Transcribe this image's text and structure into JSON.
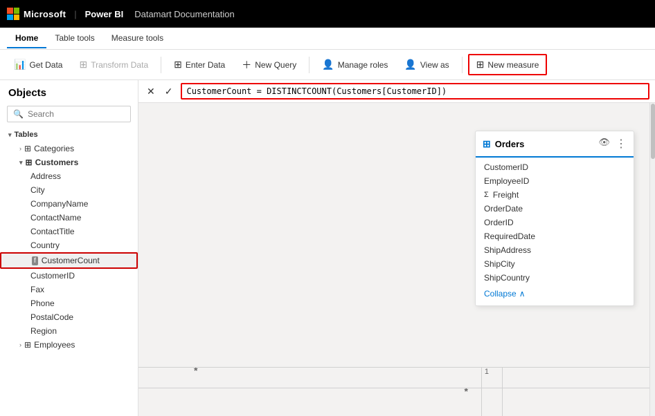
{
  "titleBar": {
    "microsoftText": "Microsoft",
    "powerBIText": "Power BI",
    "divider": "|",
    "docTitle": "Datamart Documentation"
  },
  "ribbonTabs": [
    {
      "label": "Home",
      "active": true
    },
    {
      "label": "Table tools",
      "active": false
    },
    {
      "label": "Measure tools",
      "active": false
    }
  ],
  "toolbar": {
    "getDataLabel": "Get Data",
    "transformDataLabel": "Transform Data",
    "enterDataLabel": "Enter Data",
    "newQueryLabel": "New Query",
    "manageRolesLabel": "Manage roles",
    "viewAsLabel": "View as",
    "newMeasureLabel": "New measure"
  },
  "sidebar": {
    "objectsLabel": "Objects",
    "searchPlaceholder": "Search",
    "tablesLabel": "Tables",
    "trees": [
      {
        "label": "Categories",
        "indent": "indent1",
        "type": "table",
        "collapsed": true
      },
      {
        "label": "Customers",
        "indent": "indent1",
        "type": "table",
        "collapsed": false,
        "expanded": true
      },
      {
        "label": "Address",
        "indent": "indent3",
        "type": "field"
      },
      {
        "label": "City",
        "indent": "indent3",
        "type": "field"
      },
      {
        "label": "CompanyName",
        "indent": "indent3",
        "type": "field"
      },
      {
        "label": "ContactName",
        "indent": "indent3",
        "type": "field"
      },
      {
        "label": "ContactTitle",
        "indent": "indent3",
        "type": "field"
      },
      {
        "label": "Country",
        "indent": "indent3",
        "type": "field"
      },
      {
        "label": "CustomerCount",
        "indent": "indent3",
        "type": "measure",
        "highlighted": true
      },
      {
        "label": "CustomerID",
        "indent": "indent3",
        "type": "field"
      },
      {
        "label": "Fax",
        "indent": "indent3",
        "type": "field"
      },
      {
        "label": "Phone",
        "indent": "indent3",
        "type": "field"
      },
      {
        "label": "PostalCode",
        "indent": "indent3",
        "type": "field"
      },
      {
        "label": "Region",
        "indent": "indent3",
        "type": "field"
      },
      {
        "label": "Employees",
        "indent": "indent1",
        "type": "table",
        "collapsed": true
      }
    ]
  },
  "formulaBar": {
    "formula": "CustomerCount = DISTINCTCOUNT(Customers[CustomerID])",
    "cancelSymbol": "✕",
    "confirmSymbol": "✓"
  },
  "ordersCard": {
    "title": "Orders",
    "tableIcon": "🔲",
    "fields": [
      {
        "name": "CustomerID",
        "hasSumIcon": false
      },
      {
        "name": "EmployeeID",
        "hasSumIcon": false
      },
      {
        "name": "Freight",
        "hasSumIcon": true
      },
      {
        "name": "OrderDate",
        "hasSumIcon": false
      },
      {
        "name": "OrderID",
        "hasSumIcon": false
      },
      {
        "name": "RequiredDate",
        "hasSumIcon": false
      },
      {
        "name": "ShipAddress",
        "hasSumIcon": false
      },
      {
        "name": "ShipCity",
        "hasSumIcon": false
      },
      {
        "name": "ShipCountry",
        "hasSumIcon": false
      }
    ],
    "collapseLabel": "Collapse"
  }
}
